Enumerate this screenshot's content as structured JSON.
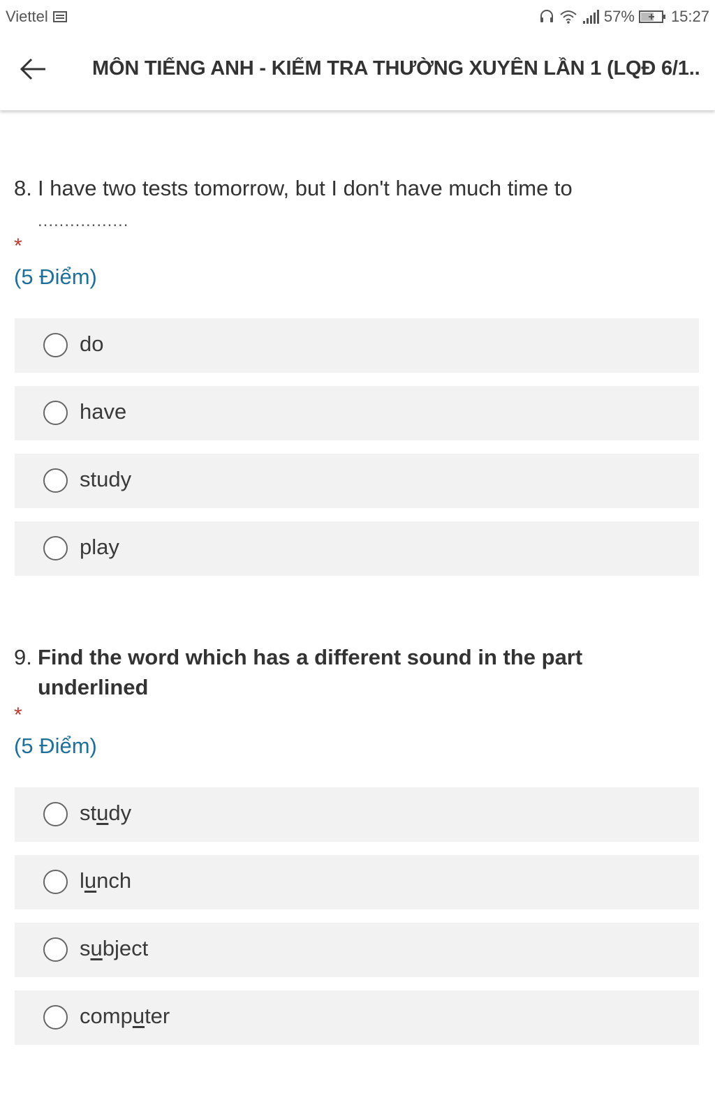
{
  "status_bar": {
    "carrier": "Viettel",
    "battery_percent": "57%",
    "time": "15:27",
    "icons": [
      "sim-card-icon",
      "headset-icon",
      "wifi-icon",
      "signal-icon",
      "battery-charging-icon"
    ]
  },
  "header": {
    "title": "MÔN TIẾNG ANH - KIỂM TRA THƯỜNG XUYÊN LẦN 1 (LQĐ 6/1..",
    "back_icon": "back-arrow-icon"
  },
  "questions": [
    {
      "number": "8.",
      "text": "I have two tests tomorrow, but I don't have much time to",
      "blank": ".................",
      "required_mark": "*",
      "points": "(5 Điểm)",
      "options": [
        {
          "label": "do"
        },
        {
          "label": "have"
        },
        {
          "label": "study"
        },
        {
          "label": "play"
        }
      ]
    },
    {
      "number": "9.",
      "text_line1": "Find the word which has a different sound in the part",
      "text_line2": "underlined",
      "required_mark": "*",
      "points": "(5 Điểm)",
      "options": [
        {
          "pre": "st",
          "underlined": "u",
          "post": "dy"
        },
        {
          "pre": "l",
          "underlined": "u",
          "post": "nch"
        },
        {
          "pre": "s",
          "underlined": "u",
          "post": "bject"
        },
        {
          "pre": "comp",
          "underlined": "u",
          "post": "ter"
        }
      ]
    }
  ]
}
